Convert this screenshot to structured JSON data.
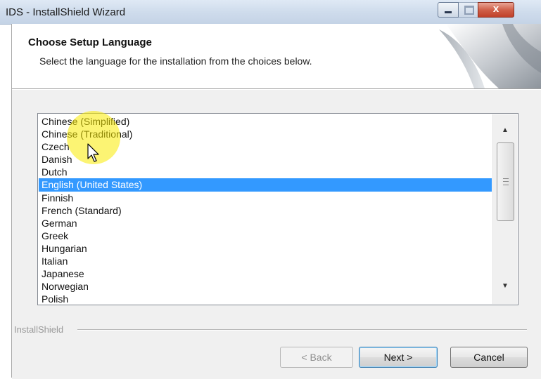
{
  "window": {
    "title": "IDS - InstallShield Wizard",
    "minimize_glyph": "",
    "maximize_glyph": "",
    "close_glyph": "x"
  },
  "header": {
    "title": "Choose Setup Language",
    "subtitle": "Select the language for the installation from the choices below."
  },
  "languages": {
    "items": [
      "Chinese (Simplified)",
      "Chinese (Traditional)",
      "Czech",
      "Danish",
      "Dutch",
      "English (United States)",
      "Finnish",
      "French (Standard)",
      "German",
      "Greek",
      "Hungarian",
      "Italian",
      "Japanese",
      "Norwegian",
      "Polish"
    ],
    "selected": "English (United States)"
  },
  "scrollbar": {
    "up_glyph": "▲",
    "down_glyph": "▼"
  },
  "footer": {
    "group_label": "InstallShield",
    "back_label": "< Back",
    "next_label": "Next >",
    "cancel_label": "Cancel"
  },
  "colors": {
    "selection": "#3399ff",
    "cursor_highlight": "#f5e600",
    "close_button": "#c8503a"
  }
}
